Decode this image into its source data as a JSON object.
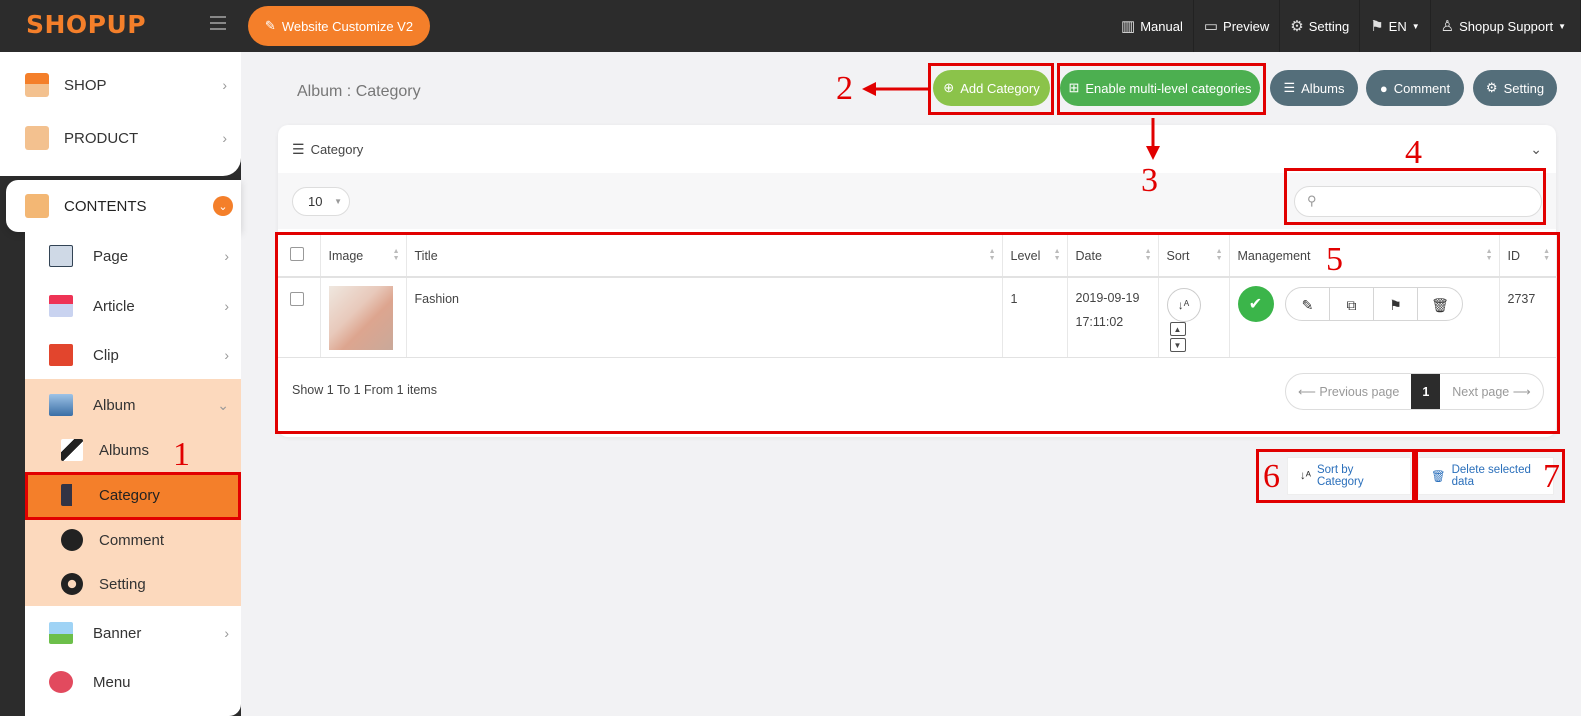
{
  "app": {
    "logo": "SHOPUP"
  },
  "topbar": {
    "customize_label": "Website Customize V2",
    "items": [
      {
        "icon": "book-icon",
        "label": "Manual"
      },
      {
        "icon": "monitor-icon",
        "label": "Preview"
      },
      {
        "icon": "gear-icon",
        "label": "Setting"
      },
      {
        "icon": "flag-icon",
        "label": "EN"
      },
      {
        "icon": "user-icon",
        "label": "Shopup Support"
      }
    ]
  },
  "sidebar": {
    "shop": "SHOP",
    "product": "PRODUCT",
    "contents": "CONTENTS",
    "page": "Page",
    "article": "Article",
    "clip": "Clip",
    "album": "Album",
    "albums": "Albums",
    "category": "Category",
    "comment": "Comment",
    "setting": "Setting",
    "banner": "Banner",
    "menu": "Menu"
  },
  "main": {
    "title": "Album : Category",
    "actions": {
      "add_category": "Add Category",
      "enable_multi": "Enable multi-level categories",
      "albums": "Albums",
      "comment": "Comment",
      "setting": "Setting"
    },
    "card_title": "Category",
    "page_size": "10",
    "search_placeholder": "",
    "columns": [
      "Image",
      "Title",
      "Level",
      "Date",
      "Sort",
      "Management",
      "ID"
    ],
    "rows": [
      {
        "title": "Fashion",
        "level": "1",
        "date": "2019-09-19",
        "time": "17:11:02",
        "id": "2737"
      }
    ],
    "summary": "Show 1 To 1 From 1 items",
    "pager": {
      "prev": "⟵ Previous page",
      "current": "1",
      "next": "Next page ⟶"
    },
    "sort_by_category": "Sort by Category",
    "delete_selected": "Delete selected data"
  },
  "annotations": [
    "1",
    "2",
    "3",
    "4",
    "5",
    "6",
    "7"
  ],
  "colors": {
    "brand": "#f47f2a",
    "dark": "#2c2c2c",
    "green": "#8bc34a",
    "darkgreen": "#4caf50",
    "slate": "#546e7a",
    "annotation": "#e10000"
  }
}
